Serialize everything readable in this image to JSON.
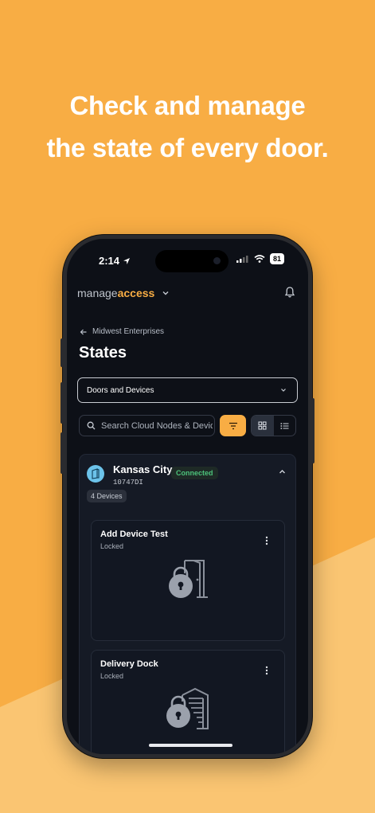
{
  "headline": {
    "line1": "Check and manage",
    "line2": "the state of every door."
  },
  "colors": {
    "background": "#F8AD44",
    "background_light": "#FAC572",
    "accent": "#F8AD44",
    "connected": "#4CC27A",
    "screen_bg": "#0D1017"
  },
  "status_bar": {
    "time": "2:14",
    "battery": "81"
  },
  "header": {
    "brand_prefix": "manage",
    "brand_accent": "access",
    "brand_icon": "chevron-down-icon",
    "notifications_icon": "bell-icon"
  },
  "breadcrumb": {
    "label": "Midwest Enterprises"
  },
  "page": {
    "title": "States"
  },
  "filter_select": {
    "value": "Doors and Devices"
  },
  "search": {
    "placeholder": "Search Cloud Nodes & Devices"
  },
  "site": {
    "name": "Kansas City",
    "code": "10747DI",
    "status": "Connected",
    "device_count": "4 Devices",
    "devices": [
      {
        "name": "Add Device Test",
        "state": "Locked",
        "icon": "door-lock-icon"
      },
      {
        "name": "Delivery Dock",
        "state": "Locked",
        "icon": "garage-lock-icon"
      }
    ]
  }
}
